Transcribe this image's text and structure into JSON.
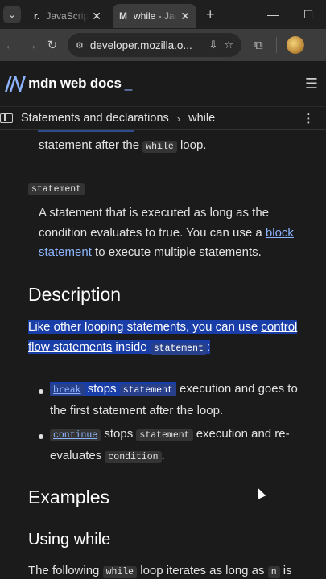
{
  "browser": {
    "tabs": [
      {
        "title": "JavaScript",
        "favicon": "r.",
        "active": false
      },
      {
        "title": "while - JavaScript",
        "favicon": "M",
        "active": true
      }
    ],
    "url": "developer.mozilla.o..."
  },
  "mdn": {
    "logo_text": "mdn web docs",
    "cursor": "_",
    "breadcrumb": [
      "Statements and declarations",
      "while"
    ]
  },
  "content": {
    "p1_text": "statement after the",
    "p1_code": "while",
    "p1_end": "loop.",
    "param_code": "statement",
    "p2_a": "A statement that is executed as long as the condition evaluates to true. You can use a",
    "p2_link": "block statement",
    "p2_b": "to execute multiple statements.",
    "h_description": "Description",
    "desc_a": "Like other looping statements, you can use",
    "desc_link": "control flow statements",
    "desc_b": "inside",
    "desc_code": "statement",
    "desc_c": ":",
    "li1_code1": "break",
    "li1_a": "stops",
    "li1_code2": "statement",
    "li1_b": "execution and goes to the first statement after the loop.",
    "li2_code1": "continue",
    "li2_a": "stops",
    "li2_code2": "statement",
    "li2_b": "execution and re-evaluates",
    "li2_code3": "condition",
    "li2_c": ".",
    "h_examples": "Examples",
    "h_using": "Using while",
    "last_a": "The following",
    "last_code1": "while",
    "last_b": "loop iterates as long as",
    "last_code2": "n",
    "last_c": "is"
  },
  "colors": {
    "accent": "#8cb4ff",
    "selection": "#1a3ea8",
    "bg": "#1b1b1b"
  }
}
